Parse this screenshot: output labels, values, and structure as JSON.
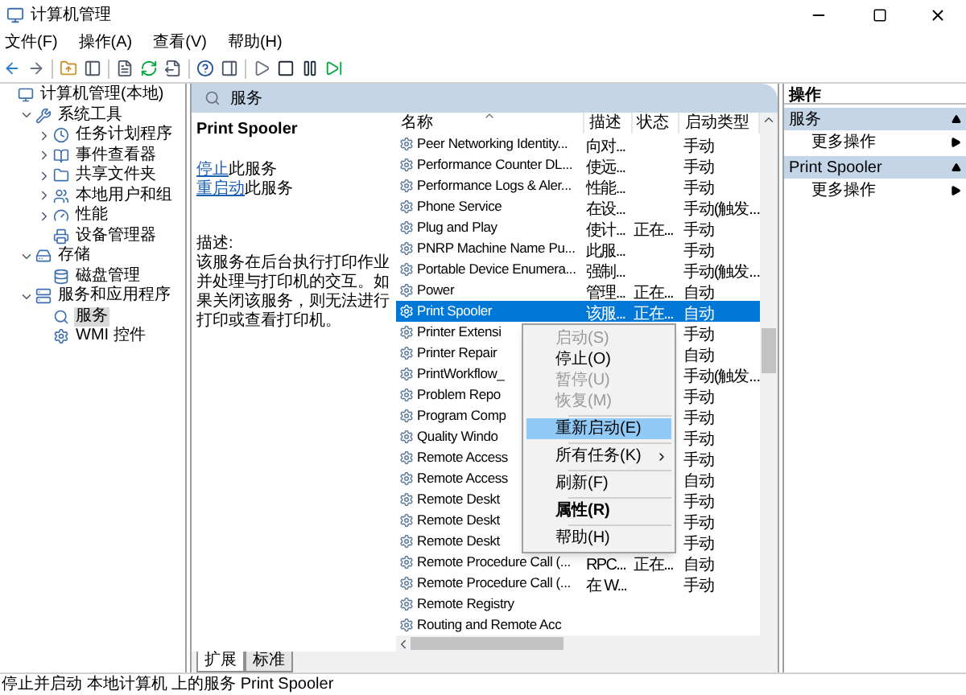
{
  "window": {
    "title": "计算机管理"
  },
  "menu": [
    "文件(F)",
    "操作(A)",
    "查看(V)",
    "帮助(H)"
  ],
  "tree": [
    {
      "label": "计算机管理(本地)",
      "selected": false,
      "children": [
        {
          "label": "系统工具",
          "kind": "node",
          "expanded": true,
          "selected": false,
          "children": [
            {
              "label": "任务计划程序",
              "kind": "node",
              "expanded": false,
              "selected": false
            },
            {
              "label": "事件查看器",
              "kind": "node",
              "expanded": false,
              "selected": false
            },
            {
              "label": "共享文件夹",
              "kind": "node",
              "expanded": false,
              "selected": false
            },
            {
              "label": "本地用户和组",
              "kind": "node",
              "expanded": false,
              "selected": false
            },
            {
              "label": "性能",
              "kind": "node",
              "expanded": false,
              "selected": false
            },
            {
              "label": "设备管理器",
              "kind": "leaf",
              "selected": false
            }
          ]
        },
        {
          "label": "存储",
          "kind": "node",
          "expanded": true,
          "selected": false,
          "children": [
            {
              "label": "磁盘管理",
              "kind": "leaf",
              "selected": false
            }
          ]
        },
        {
          "label": "服务和应用程序",
          "kind": "node",
          "expanded": true,
          "selected": false,
          "children": [
            {
              "label": "服务",
              "kind": "leaf",
              "selected": true
            },
            {
              "label": "WMI 控件",
              "kind": "leaf",
              "selected": false
            }
          ]
        }
      ]
    }
  ],
  "center": {
    "header": "服务",
    "detail": {
      "title": "Print Spooler",
      "links": [
        {
          "link": "停止",
          "rest": "此服务"
        },
        {
          "link": "重启动",
          "rest": "此服务"
        }
      ],
      "description_label": "描述:",
      "description": "该服务在后台执行打印作业并处理与打印机的交互。如果关闭该服务，则无法进行打印或查看打印机。"
    },
    "columns": [
      "名称",
      "描述",
      "状态",
      "启动类型"
    ],
    "rows": [
      {
        "name": "Peer Networking Identity...",
        "description": "向对...",
        "status": "",
        "startup": "手动",
        "selected": false
      },
      {
        "name": "Performance Counter DL...",
        "description": "使远...",
        "status": "",
        "startup": "手动",
        "selected": false
      },
      {
        "name": "Performance Logs & Aler...",
        "description": "性能...",
        "status": "",
        "startup": "手动",
        "selected": false
      },
      {
        "name": "Phone Service",
        "description": "在设...",
        "status": "",
        "startup": "手动(触发...",
        "selected": false
      },
      {
        "name": "Plug and Play",
        "description": "使计...",
        "status": "正在...",
        "startup": "手动",
        "selected": false
      },
      {
        "name": "PNRP Machine Name Pu...",
        "description": "此服...",
        "status": "",
        "startup": "手动",
        "selected": false
      },
      {
        "name": "Portable Device Enumera...",
        "description": "强制...",
        "status": "",
        "startup": "手动(触发...",
        "selected": false
      },
      {
        "name": "Power",
        "description": "管理...",
        "status": "正在...",
        "startup": "自动",
        "selected": false
      },
      {
        "name": "Print Spooler",
        "description": "该服...",
        "status": "正在...",
        "startup": "自动",
        "selected": true
      },
      {
        "name": "Printer Extensi",
        "description": "",
        "status": "",
        "startup": "手动",
        "selected": false
      },
      {
        "name": "Printer Repair",
        "description": "",
        "status": "",
        "startup": "自动",
        "selected": false
      },
      {
        "name": "PrintWorkflow_",
        "description": "",
        "status": "",
        "startup": "手动(触发...",
        "selected": false
      },
      {
        "name": "Problem Repo",
        "description": "",
        "status": "",
        "startup": "手动",
        "selected": false
      },
      {
        "name": "Program Comp",
        "description": "",
        "status": "",
        "startup": "手动",
        "selected": false
      },
      {
        "name": "Quality Windo",
        "description": "",
        "status": "",
        "startup": "手动",
        "selected": false
      },
      {
        "name": "Remote Access",
        "description": "",
        "status": "",
        "startup": "手动",
        "selected": false
      },
      {
        "name": "Remote Access",
        "description": "",
        "status": "",
        "startup": "自动",
        "selected": false
      },
      {
        "name": "Remote Deskt",
        "description": "",
        "status": "",
        "startup": "手动",
        "selected": false
      },
      {
        "name": "Remote Deskt",
        "description": "",
        "status": "",
        "startup": "手动",
        "selected": false
      },
      {
        "name": "Remote Deskt",
        "description": "",
        "status": "",
        "startup": "手动",
        "selected": false
      },
      {
        "name": "Remote Procedure Call (...",
        "description": "RPC...",
        "status": "正在...",
        "startup": "自动",
        "selected": false
      },
      {
        "name": "Remote Procedure Call (...",
        "description": "在 W...",
        "status": "",
        "startup": "手动",
        "selected": false
      },
      {
        "name": "Remote Registry",
        "description": "",
        "status": "",
        "startup": "",
        "selected": false
      },
      {
        "name": "Routing and Remote Acc",
        "description": "",
        "status": "",
        "startup": "",
        "selected": false
      }
    ],
    "context_menu": [
      {
        "kind": "item",
        "label": "启动(S)",
        "disabled": true,
        "selected": false,
        "default": false,
        "submenu": false
      },
      {
        "kind": "item",
        "label": "停止(O)",
        "disabled": false,
        "selected": false,
        "default": false,
        "submenu": false
      },
      {
        "kind": "item",
        "label": "暂停(U)",
        "disabled": true,
        "selected": false,
        "default": false,
        "submenu": false
      },
      {
        "kind": "item",
        "label": "恢复(M)",
        "disabled": true,
        "selected": false,
        "default": false,
        "submenu": false
      },
      {
        "kind": "separator"
      },
      {
        "kind": "item",
        "label": "重新启动(E)",
        "disabled": false,
        "selected": true,
        "default": false,
        "submenu": false
      },
      {
        "kind": "separator"
      },
      {
        "kind": "item",
        "label": "所有任务(K)",
        "disabled": false,
        "selected": false,
        "default": false,
        "submenu": true
      },
      {
        "kind": "separator"
      },
      {
        "kind": "item",
        "label": "刷新(F)",
        "disabled": false,
        "selected": false,
        "default": false,
        "submenu": false
      },
      {
        "kind": "separator"
      },
      {
        "kind": "item",
        "label": "属性(R)",
        "disabled": false,
        "selected": false,
        "default": true,
        "submenu": false
      },
      {
        "kind": "separator"
      },
      {
        "kind": "item",
        "label": "帮助(H)",
        "disabled": false,
        "selected": false,
        "default": false,
        "submenu": false
      }
    ],
    "tabs": [
      {
        "label": "扩展",
        "selected": true
      },
      {
        "label": "标准",
        "selected": false
      }
    ]
  },
  "actions": {
    "title": "操作",
    "sections": [
      {
        "title": "服务",
        "items": [
          "更多操作"
        ]
      },
      {
        "title": "Print Spooler",
        "items": [
          "更多操作"
        ]
      }
    ]
  },
  "status_bar": "停止并启动 本地计算机 上的服务 Print Spooler"
}
